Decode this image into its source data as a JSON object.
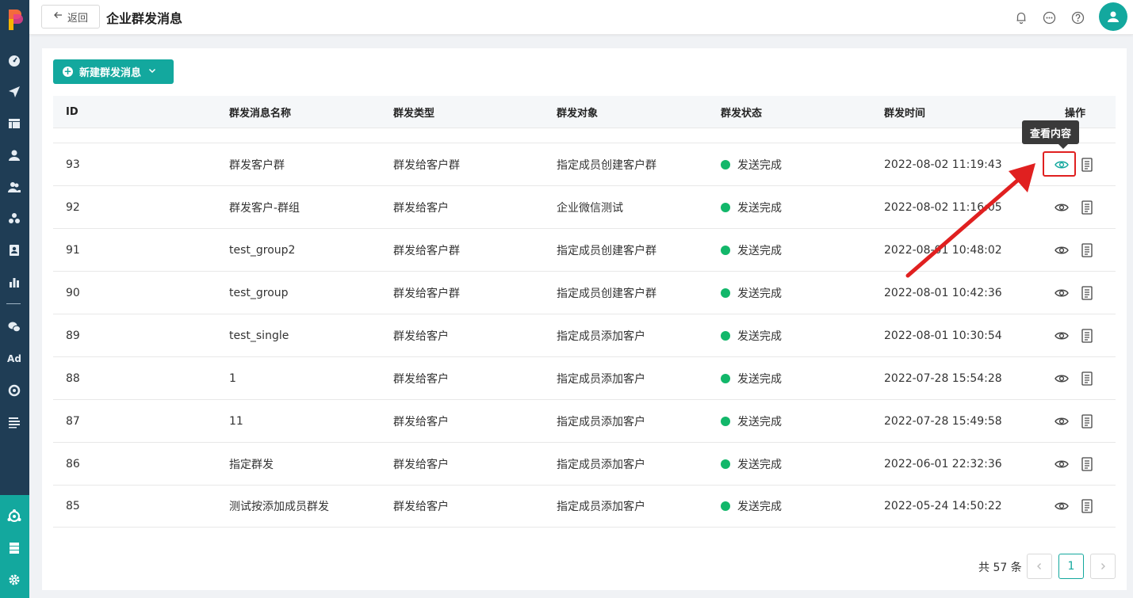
{
  "header": {
    "back_label": "返回",
    "title": "企业群发消息"
  },
  "toolbar": {
    "new_label": "新建群发消息"
  },
  "table": {
    "columns": [
      "ID",
      "群发消息名称",
      "群发类型",
      "群发对象",
      "群发状态",
      "群发时间",
      "操作"
    ],
    "rows": [
      {
        "id": "93",
        "name": "群发客户群",
        "type": "群发给客户群",
        "target": "指定成员创建客户群",
        "status": "发送完成",
        "time": "2022-08-02 11:19:43"
      },
      {
        "id": "92",
        "name": "群发客户-群组",
        "type": "群发给客户",
        "target": "企业微信测试",
        "status": "发送完成",
        "time": "2022-08-02 11:16:05"
      },
      {
        "id": "91",
        "name": "test_group2",
        "type": "群发给客户群",
        "target": "指定成员创建客户群",
        "status": "发送完成",
        "time": "2022-08-01 10:48:02"
      },
      {
        "id": "90",
        "name": "test_group",
        "type": "群发给客户群",
        "target": "指定成员创建客户群",
        "status": "发送完成",
        "time": "2022-08-01 10:42:36"
      },
      {
        "id": "89",
        "name": "test_single",
        "type": "群发给客户",
        "target": "指定成员添加客户",
        "status": "发送完成",
        "time": "2022-08-01 10:30:54"
      },
      {
        "id": "88",
        "name": "1",
        "type": "群发给客户",
        "target": "指定成员添加客户",
        "status": "发送完成",
        "time": "2022-07-28 15:54:28"
      },
      {
        "id": "87",
        "name": "11",
        "type": "群发给客户",
        "target": "指定成员添加客户",
        "status": "发送完成",
        "time": "2022-07-28 15:49:58"
      },
      {
        "id": "86",
        "name": "指定群发",
        "type": "群发给客户",
        "target": "指定成员添加客户",
        "status": "发送完成",
        "time": "2022-06-01 22:32:36"
      },
      {
        "id": "85",
        "name": "测试按添加成员群发",
        "type": "群发给客户",
        "target": "指定成员添加客户",
        "status": "发送完成",
        "time": "2022-05-24 14:50:22"
      }
    ]
  },
  "tooltip": {
    "text": "查看内容"
  },
  "pagination": {
    "total_label": "共 57 条",
    "current_page": "1"
  },
  "sidebar": {
    "ad_label": "Ad"
  },
  "colors": {
    "brand": "#13a89e",
    "sidebar": "#1f3d55",
    "status_success": "#12b76a",
    "annotation": "#e02020"
  }
}
